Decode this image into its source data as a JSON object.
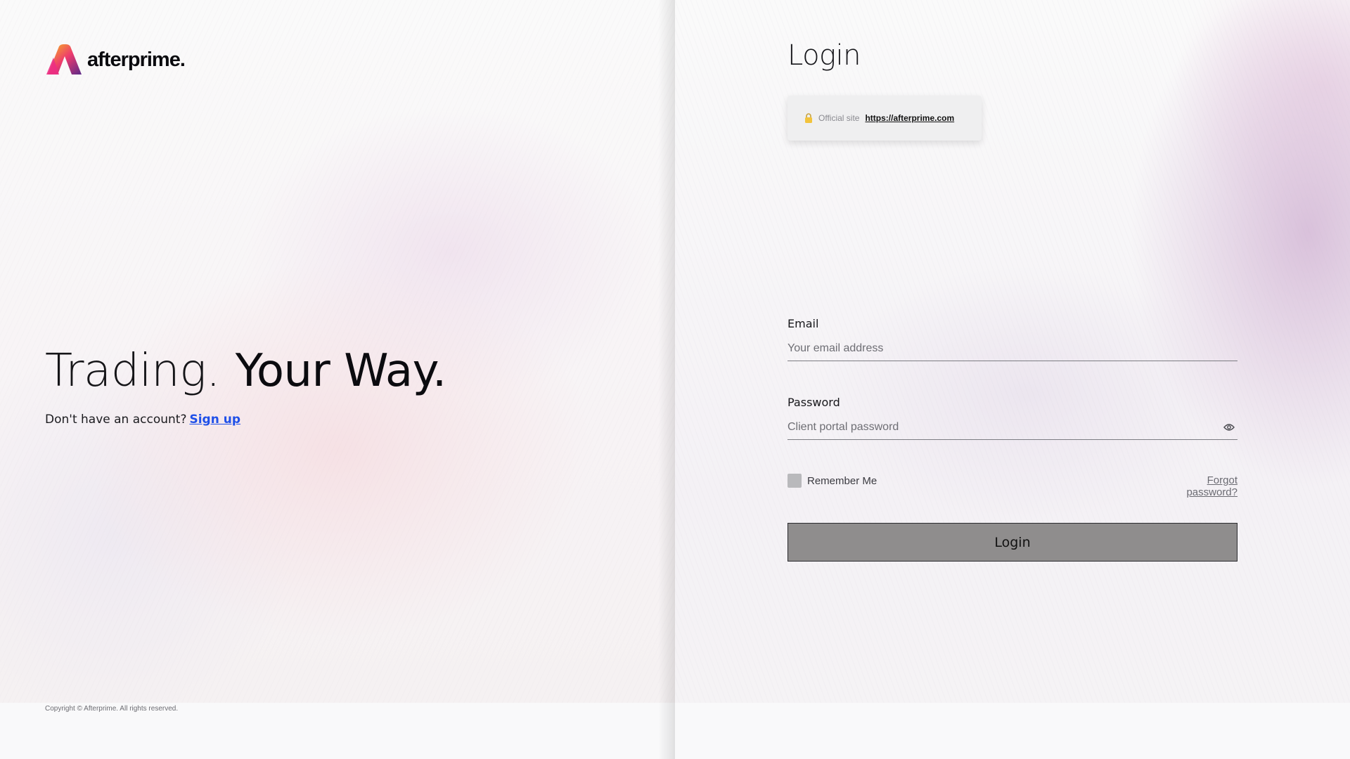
{
  "brand": {
    "logo_text": "afterprime.",
    "logo_colors": [
      "#f5b21b",
      "#ef3f6c",
      "#5a2a86"
    ]
  },
  "left": {
    "headline_light": "Trading.",
    "headline_bold": "Your Way.",
    "signup_prompt": "Don't have an account?",
    "signup_link": "Sign up",
    "copyright": "Copyright © Afterprime. All rights reserved."
  },
  "login": {
    "title": "Login",
    "official_label": "Official site",
    "official_url": "https://afterprime.com",
    "email_label": "Email",
    "email_placeholder": "Your email address",
    "email_value": "",
    "password_label": "Password",
    "password_placeholder": "Client portal password",
    "password_value": "",
    "remember_label": "Remember Me",
    "remember_checked": false,
    "forgot_link": "Forgot password?",
    "submit_label": "Login"
  },
  "icons": {
    "lock": "lock-icon",
    "eye": "eye-icon"
  },
  "colors": {
    "link": "#1f50e8",
    "button_bg": "#8f8d8d",
    "checkbox_bg": "#b9b9bc"
  }
}
